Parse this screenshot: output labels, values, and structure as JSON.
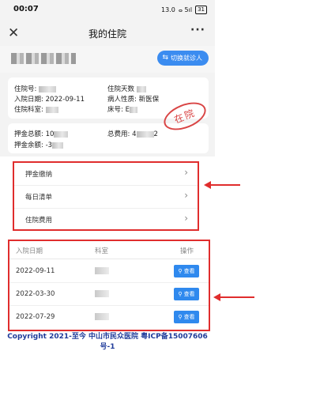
{
  "status_bar": {
    "time": "00:07",
    "net": "13.0 ",
    "signal": "ⴰ 5ıl",
    "battery": "31"
  },
  "header": {
    "title": "我的住院"
  },
  "patient": {
    "name": "",
    "switch_label": "切换就诊人"
  },
  "admission": {
    "hospital_no_label": "住院号:",
    "days_label": "住院天数",
    "date_label": "入院日期:",
    "date_value": "2022-09-11",
    "nature_label": "病人性质:",
    "nature_value": "新医保",
    "dept_label": "住院科室:",
    "bed_label": "床号:",
    "bed_value": "E",
    "status_stamp": "在院"
  },
  "money": {
    "deposit_total_label": "押金总额:",
    "deposit_total_value": "10",
    "deposit_balance_label": "押金余额:",
    "deposit_balance_value": "-3",
    "total_cost_label": "总费用:",
    "total_cost_value": "4",
    "total_cost_tail": "2"
  },
  "menu": [
    {
      "label": "押金缴纳"
    },
    {
      "label": "每日清单"
    },
    {
      "label": "住院费用"
    }
  ],
  "table": {
    "headers": [
      "入院日期",
      "科室",
      "操作"
    ],
    "rows": [
      {
        "date": "2022-09-11",
        "dept": "",
        "action": "查看"
      },
      {
        "date": "2022-03-30",
        "dept": "",
        "action": "查看"
      },
      {
        "date": "2022-07-29",
        "dept": "",
        "action": "查看"
      }
    ]
  },
  "footer": {
    "line1": "Copyright 2021-至今 中山市民众医院 粤ICP备15007606",
    "line2": "号-1"
  },
  "colors": {
    "accent": "#3b8cf0",
    "annotation_red": "#e02d2d",
    "footer_blue": "#1f3b9a"
  }
}
